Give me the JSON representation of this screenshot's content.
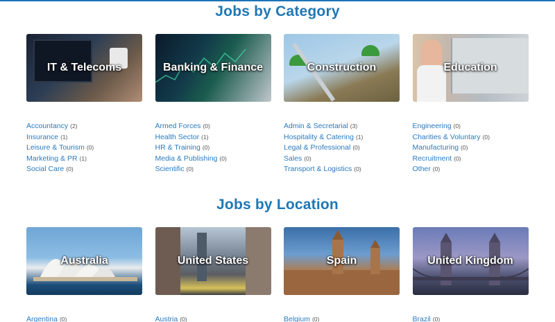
{
  "category_section": {
    "title": "Jobs by Category",
    "tiles": [
      {
        "label": "IT & Telecoms"
      },
      {
        "label": "Banking & Finance"
      },
      {
        "label": "Construction"
      },
      {
        "label": "Education"
      }
    ],
    "columns": [
      [
        {
          "name": "Accountancy",
          "count": "(2)"
        },
        {
          "name": "Insurance",
          "count": "(1)"
        },
        {
          "name": "Leisure & Tourism",
          "count": "(0)"
        },
        {
          "name": "Marketing & PR",
          "count": "(1)"
        },
        {
          "name": "Social Care",
          "count": "(0)"
        }
      ],
      [
        {
          "name": "Armed Forces",
          "count": "(0)"
        },
        {
          "name": "Health Sector",
          "count": "(1)"
        },
        {
          "name": "HR & Training",
          "count": "(0)"
        },
        {
          "name": "Media & Publishing",
          "count": "(0)"
        },
        {
          "name": "Scientific",
          "count": "(0)"
        }
      ],
      [
        {
          "name": "Admin & Secretarial",
          "count": "(3)"
        },
        {
          "name": "Hospitality & Catering",
          "count": "(1)"
        },
        {
          "name": "Legal & Professional",
          "count": "(0)"
        },
        {
          "name": "Sales",
          "count": "(0)"
        },
        {
          "name": "Transport & Logistics",
          "count": "(0)"
        }
      ],
      [
        {
          "name": "Engineering",
          "count": "(0)"
        },
        {
          "name": "Charities & Voluntary",
          "count": "(0)"
        },
        {
          "name": "Manufacturing",
          "count": "(0)"
        },
        {
          "name": "Recruitment",
          "count": "(0)"
        },
        {
          "name": "Other",
          "count": "(0)"
        }
      ]
    ]
  },
  "location_section": {
    "title": "Jobs by Location",
    "tiles": [
      {
        "label": "Australia"
      },
      {
        "label": "United States"
      },
      {
        "label": "Spain"
      },
      {
        "label": "United Kingdom"
      }
    ],
    "columns": [
      [
        {
          "name": "Argentina",
          "count": "(0)"
        }
      ],
      [
        {
          "name": "Austria",
          "count": "(0)"
        }
      ],
      [
        {
          "name": "Belgium",
          "count": "(0)"
        }
      ],
      [
        {
          "name": "Brazil",
          "count": "(0)"
        }
      ]
    ]
  },
  "colors": {
    "accent": "#1f77b4",
    "link": "#2a7abf",
    "count_text": "#555555"
  }
}
